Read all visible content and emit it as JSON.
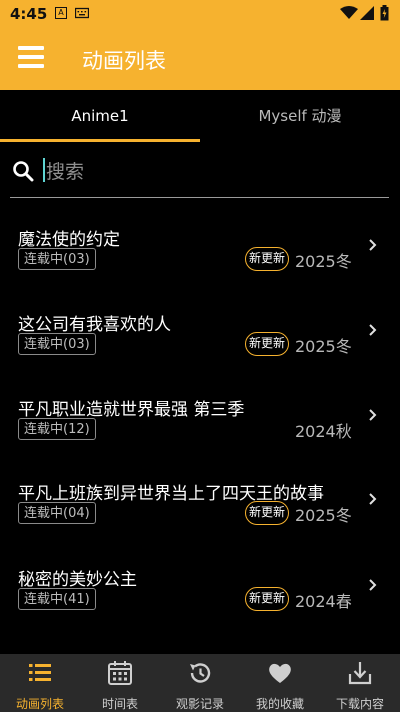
{
  "status_bar": {
    "time": "4:45",
    "note_glyph": "A"
  },
  "app_bar": {
    "title": "动画列表",
    "menu_icon": "hamburger-menu-icon"
  },
  "tabs": [
    {
      "label": "Anime1",
      "active": true
    },
    {
      "label": "Myself 动漫",
      "active": false
    }
  ],
  "search": {
    "placeholder": "搜索"
  },
  "anime_list": [
    {
      "title": "魔法使的约定",
      "status": "连载中(03)",
      "badge": "新更新",
      "season": "2025冬"
    },
    {
      "title": "这公司有我喜欢的人",
      "status": "连载中(03)",
      "badge": "新更新",
      "season": "2025冬"
    },
    {
      "title": "平凡职业造就世界最强 第三季",
      "status": "连载中(12)",
      "badge": "",
      "season": "2024秋"
    },
    {
      "title": "平凡上班族到异世界当上了四天王的故事",
      "status": "连载中(04)",
      "badge": "新更新",
      "season": "2025冬"
    },
    {
      "title": "秘密的美妙公主",
      "status": "连载中(41)",
      "badge": "新更新",
      "season": "2024春"
    }
  ],
  "bottom_nav": [
    {
      "label": "动画列表",
      "icon": "list-icon",
      "active": true
    },
    {
      "label": "时间表",
      "icon": "calendar-icon",
      "active": false
    },
    {
      "label": "观影记录",
      "icon": "history-icon",
      "active": false
    },
    {
      "label": "我的收藏",
      "icon": "heart-icon",
      "active": false
    },
    {
      "label": "下载内容",
      "icon": "download-icon",
      "active": false
    }
  ],
  "colors": {
    "accent": "#f6b22f",
    "background": "#000000",
    "bottom_nav_bg": "#2a2a2a"
  }
}
